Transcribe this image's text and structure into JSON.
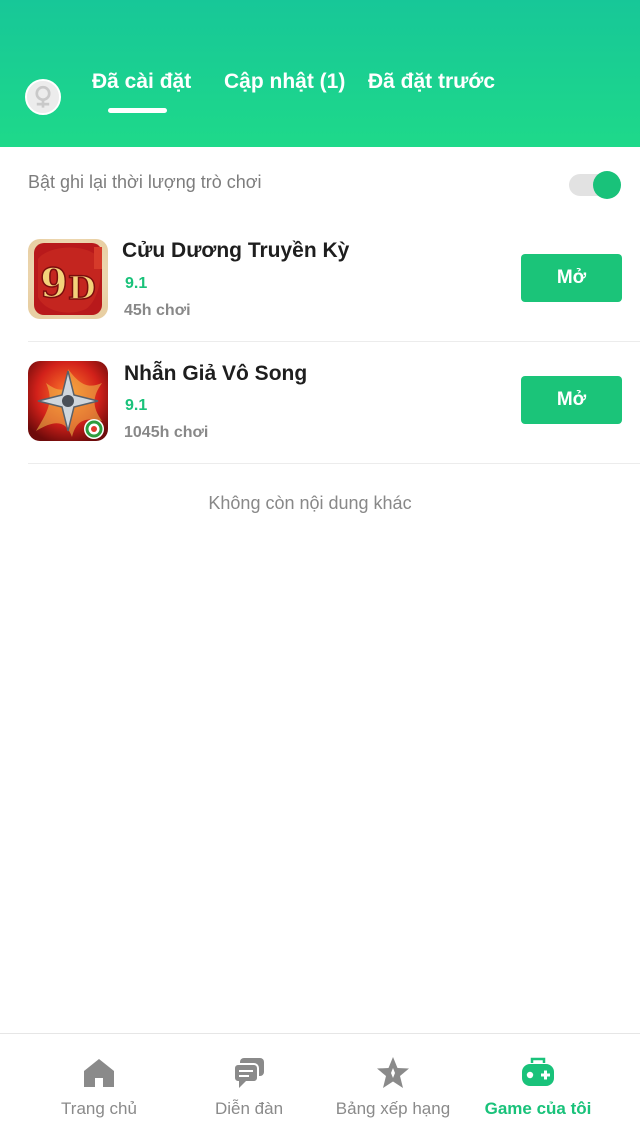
{
  "header": {
    "tabs": [
      {
        "label": "Đã cài đặt",
        "active": true
      },
      {
        "label": "Cập nhật (1)",
        "active": false
      },
      {
        "label": "Đã đặt trước",
        "active": false
      }
    ]
  },
  "settings": {
    "record_playtime_label": "Bật ghi lại thời lượng trò chơi",
    "record_playtime_enabled": true
  },
  "games": [
    {
      "name": "Cửu Dương Truyền Kỳ",
      "rating": "9.1",
      "hours": "45h chơi",
      "button": "Mở",
      "icon": "game-9d-icon"
    },
    {
      "name": "Nhẫn Giả Vô Song",
      "rating": "9.1",
      "hours": "1045h chơi",
      "button": "Mở",
      "icon": "ninja-shuriken-icon"
    }
  ],
  "end_message": "Không còn nội dung khác",
  "bottom_nav": [
    {
      "label": "Trang chủ",
      "icon": "home-icon",
      "active": false
    },
    {
      "label": "Diễn đàn",
      "icon": "forum-icon",
      "active": false
    },
    {
      "label": "Bảng xếp hạng",
      "icon": "star-ranking-icon",
      "active": false
    },
    {
      "label": "Game của tôi",
      "icon": "gamepad-icon",
      "active": true
    }
  ],
  "colors": {
    "accent": "#19c27a",
    "header_gradient_top": "#17c798",
    "header_gradient_bottom": "#1ed98a"
  }
}
